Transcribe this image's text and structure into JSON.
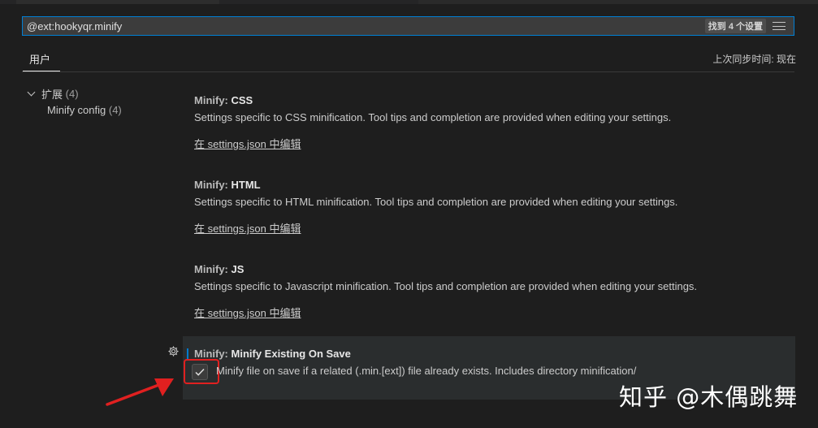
{
  "search": {
    "value": "@ext:hookyqr.minify",
    "result_count": "找到 4 个设置"
  },
  "header": {
    "scope_tab": "用户",
    "sync_status": "上次同步时间: 现在"
  },
  "toc": {
    "group_label": "扩展",
    "group_count": "(4)",
    "item_label": "Minify config",
    "item_count": "(4)"
  },
  "settings": [
    {
      "category": "Minify: ",
      "key": "CSS",
      "description": "Settings specific to CSS minification. Tool tips and completion are provided when editing your settings.",
      "link": "在 settings.json 中编辑"
    },
    {
      "category": "Minify: ",
      "key": "HTML",
      "description": "Settings specific to HTML minification. Tool tips and completion are provided when editing your settings.",
      "link": "在 settings.json 中编辑"
    },
    {
      "category": "Minify: ",
      "key": "JS",
      "description": "Settings specific to Javascript minification. Tool tips and completion are provided when editing your settings.",
      "link": "在 settings.json 中编辑"
    },
    {
      "category": "Minify: ",
      "key": "Minify Existing On Save",
      "description": "Minify file on save if a related (.min.[ext]) file already exists. Includes directory minification/",
      "checked": true
    }
  ],
  "watermark": "知乎 @木偶跳舞",
  "colors": {
    "accent": "#007fd4",
    "highlight_box": "#e02020",
    "background": "#1e1e1e"
  }
}
